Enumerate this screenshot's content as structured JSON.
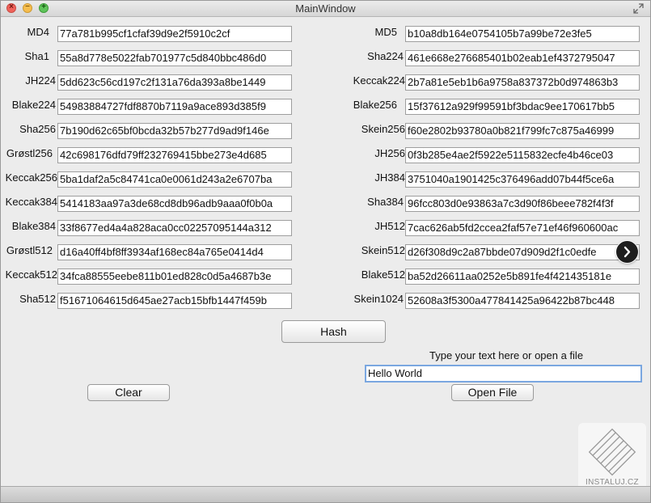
{
  "window": {
    "title": "MainWindow"
  },
  "titlebar": {
    "close_glyph": "×",
    "min_glyph": "–",
    "max_glyph": "+"
  },
  "left_fields": [
    {
      "label": "MD4",
      "value": "77a781b995cf1cfaf39d9e2f5910c2cf"
    },
    {
      "label": "Sha1",
      "value": "55a8d778e5022fab701977c5d840bbc486d0"
    },
    {
      "label": "JH224",
      "value": "5dd623c56cd197c2f131a76da393a8be1449"
    },
    {
      "label": "Blake224",
      "value": "54983884727fdf8870b7119a9ace893d385f9"
    },
    {
      "label": "Sha256",
      "value": "7b190d62c65bf0bcda32b57b277d9ad9f146e"
    },
    {
      "label": "Grøstl256",
      "value": "42c698176dfd79ff232769415bbe273e4d685"
    },
    {
      "label": "Keccak256",
      "value": "5ba1daf2a5c84741ca0e0061d243a2e6707ba"
    },
    {
      "label": "Keccak384",
      "value": "5414183aa97a3de68cd8db96adb9aaa0f0b0a"
    },
    {
      "label": "Blake384",
      "value": "33f8677ed4a4a828aca0cc02257095144a312"
    },
    {
      "label": "Grøstl512",
      "value": "d16a40ff4bf8ff3934af168ec84a765e0414d4"
    },
    {
      "label": "Keccak512",
      "value": "34fca88555eebe811b01ed828c0d5a4687b3e"
    },
    {
      "label": "Sha512",
      "value": "f51671064615d645ae27acb15bfb1447f459b"
    }
  ],
  "right_fields": [
    {
      "label": "MD5",
      "value": "b10a8db164e0754105b7a99be72e3fe5"
    },
    {
      "label": "Sha224",
      "value": "461e668e276685401b02eab1ef4372795047"
    },
    {
      "label": "Keccak224",
      "value": "2b7a81e5eb1b6a9758a837372b0d974863b3"
    },
    {
      "label": "Blake256",
      "value": "15f37612a929f99591bf3bdac9ee170617bb5"
    },
    {
      "label": "Skein256",
      "value": "f60e2802b93780a0b821f799fc7c875a46999"
    },
    {
      "label": "JH256",
      "value": "0f3b285e4ae2f5922e5115832ecfe4b46ce03"
    },
    {
      "label": "JH384",
      "value": "3751040a1901425c376496add07b44f5ce6a"
    },
    {
      "label": "Sha384",
      "value": "96fcc803d0e93863a7c3d90f86beee782f4f3f"
    },
    {
      "label": "JH512",
      "value": "7cac626ab5fd2ccea2faf57e71ef46f960600ac"
    },
    {
      "label": "Skein512",
      "value": "d26f308d9c2a87bbde07d909d2f1c0edfe"
    },
    {
      "label": "Blake512",
      "value": "ba52d26611aa0252e5b891fe4f421435181e"
    },
    {
      "label": "Skein1024",
      "value": "52608a3f5300a477841425a96422b87bc448"
    }
  ],
  "buttons": {
    "hash": "Hash",
    "clear": "Clear",
    "open_file": "Open File"
  },
  "input": {
    "hint": "Type your text here or open a file",
    "value": "Hello World"
  },
  "watermark": {
    "text": "INSTALUJ.CZ"
  },
  "icons": {
    "chevron": "chevron-right-icon",
    "fullscreen": "fullscreen-icon"
  }
}
